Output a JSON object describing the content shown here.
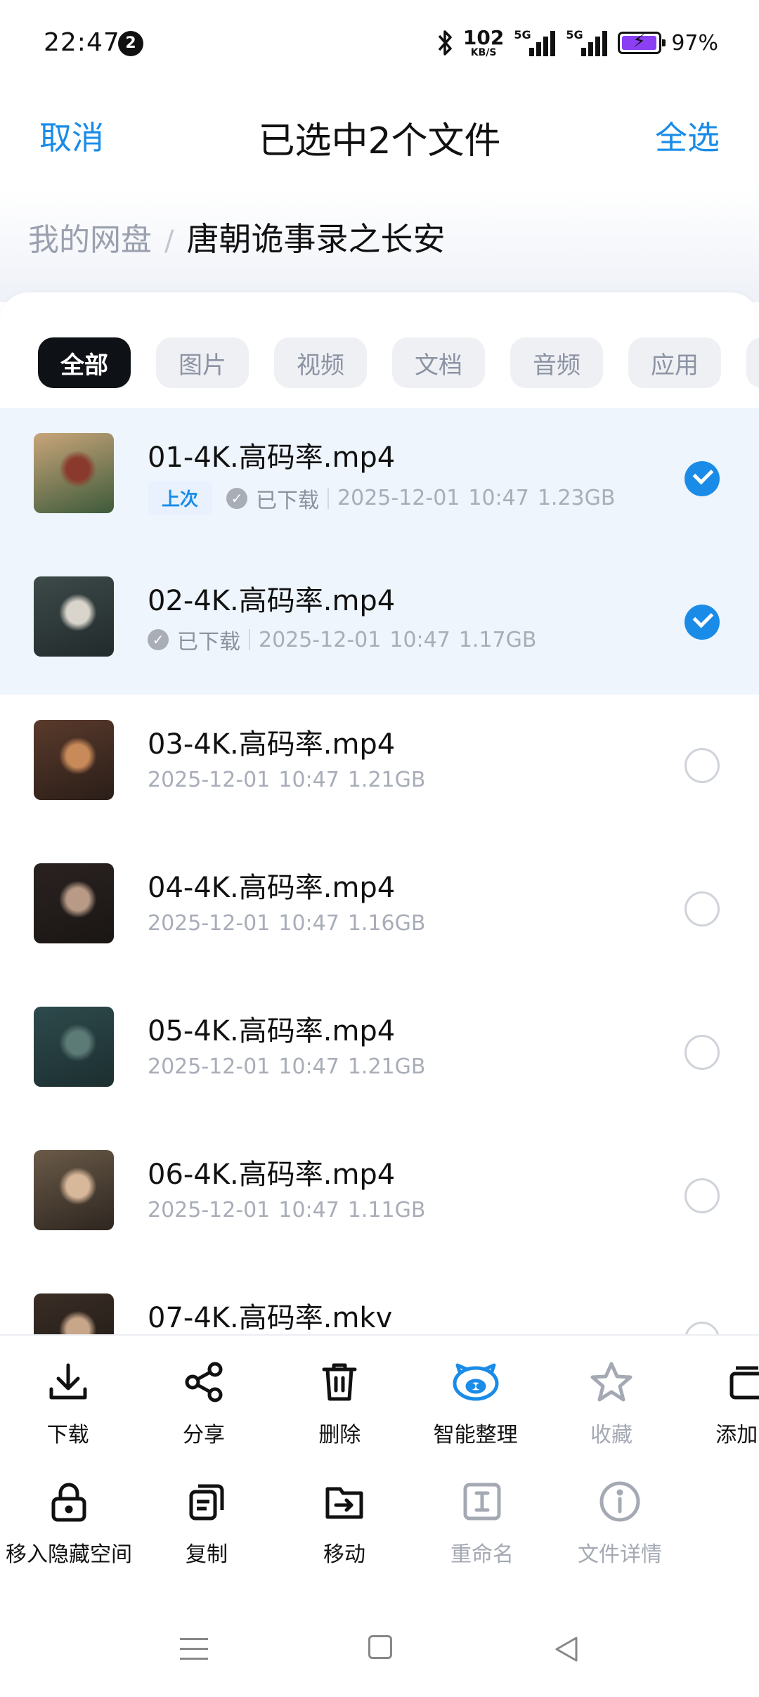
{
  "status_bar": {
    "time": "22:47",
    "notification_count": "2",
    "net_speed_value": "102",
    "net_speed_unit": "KB/S",
    "sim1_label": "5G",
    "sim2_label": "5G",
    "battery_percent": "97%",
    "battery_level": 0.97
  },
  "header": {
    "cancel_label": "取消",
    "title": "已选中2个文件",
    "select_all_label": "全选"
  },
  "breadcrumb": {
    "root": "我的网盘",
    "separator": "/",
    "current": "唐朝诡事录之长安"
  },
  "filters": [
    {
      "label": "全部",
      "active": true
    },
    {
      "label": "图片",
      "active": false
    },
    {
      "label": "视频",
      "active": false
    },
    {
      "label": "文档",
      "active": false
    },
    {
      "label": "音频",
      "active": false
    },
    {
      "label": "应用",
      "active": false
    }
  ],
  "files": [
    {
      "name": "01-4K.高码率.mp4",
      "badge": "上次",
      "downloaded_label": "已下载",
      "date": "2025-12-01",
      "time": "10:47",
      "size": "1.23GB",
      "selected": true,
      "thumb_colors": [
        "#c9a57a",
        "#8a3a2c",
        "#3d5a3a"
      ]
    },
    {
      "name": "02-4K.高码率.mp4",
      "badge": "",
      "downloaded_label": "已下载",
      "date": "2025-12-01",
      "time": "10:47",
      "size": "1.17GB",
      "selected": true,
      "thumb_colors": [
        "#3c4a48",
        "#d9d5cc",
        "#222a2c"
      ]
    },
    {
      "name": "03-4K.高码率.mp4",
      "badge": "",
      "downloaded_label": "",
      "date": "2025-12-01",
      "time": "10:47",
      "size": "1.21GB",
      "selected": false,
      "thumb_colors": [
        "#5a3a2c",
        "#c98a5a",
        "#2a1e18"
      ]
    },
    {
      "name": "04-4K.高码率.mp4",
      "badge": "",
      "downloaded_label": "",
      "date": "2025-12-01",
      "time": "10:47",
      "size": "1.16GB",
      "selected": false,
      "thumb_colors": [
        "#2a2220",
        "#b89a86",
        "#1a1614"
      ]
    },
    {
      "name": "05-4K.高码率.mp4",
      "badge": "",
      "downloaded_label": "",
      "date": "2025-12-01",
      "time": "10:47",
      "size": "1.21GB",
      "selected": false,
      "thumb_colors": [
        "#2e4a4c",
        "#5c7a76",
        "#1c2e30"
      ]
    },
    {
      "name": "06-4K.高码率.mp4",
      "badge": "",
      "downloaded_label": "",
      "date": "2025-12-01",
      "time": "10:47",
      "size": "1.11GB",
      "selected": false,
      "thumb_colors": [
        "#6a5a48",
        "#d8b89a",
        "#2e2620"
      ]
    },
    {
      "name": "07-4K.高码率.mkv",
      "badge": "",
      "downloaded_label": "",
      "date": "",
      "time": "",
      "size": "",
      "selected": false,
      "thumb_colors": [
        "#3a2e26",
        "#c8a68a",
        "#1e1814"
      ]
    }
  ],
  "toolbar": {
    "row1": [
      {
        "label": "下载",
        "icon": "download-icon",
        "disabled": false
      },
      {
        "label": "分享",
        "icon": "share-icon",
        "disabled": false
      },
      {
        "label": "删除",
        "icon": "trash-icon",
        "disabled": false
      },
      {
        "label": "智能整理",
        "icon": "smart-organize-icon",
        "disabled": false
      },
      {
        "label": "收藏",
        "icon": "star-icon",
        "disabled": true
      },
      {
        "label": "添加到",
        "icon": "add-to-icon",
        "disabled": false
      }
    ],
    "row2": [
      {
        "label": "移入隐藏空间",
        "icon": "lock-icon",
        "disabled": false
      },
      {
        "label": "复制",
        "icon": "copy-icon",
        "disabled": false
      },
      {
        "label": "移动",
        "icon": "move-icon",
        "disabled": false
      },
      {
        "label": "重命名",
        "icon": "rename-icon",
        "disabled": true
      },
      {
        "label": "文件详情",
        "icon": "info-icon",
        "disabled": true
      }
    ]
  },
  "colors": {
    "accent": "#1a8ce8",
    "selected_row_bg": "#eef5fd",
    "chip_active_bg": "#0e1216",
    "battery_fill": "#8a3ff2"
  }
}
